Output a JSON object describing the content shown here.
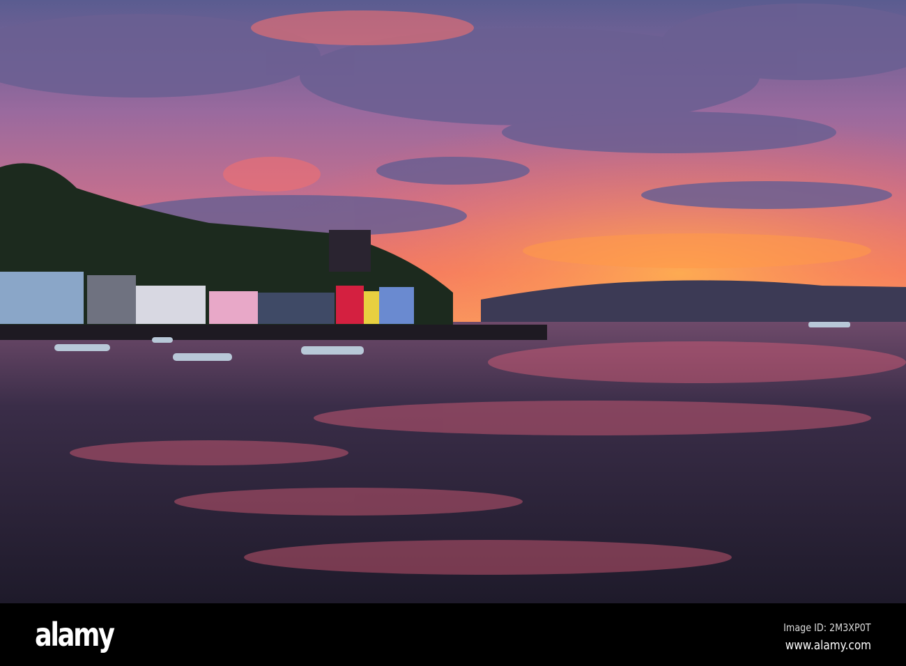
{
  "photo": {
    "subject": "harbour-town-sunset",
    "colors": {
      "sky_top": "#5b5a8e",
      "glow": "#f56a5a",
      "horizon": "#f7904f",
      "water": "#2b2438",
      "hill": "#1d2a1c",
      "mountain": "#3a3a55"
    }
  },
  "watermark": {
    "logo": "alamy",
    "image_id": "Image ID: 2M3XP0T",
    "website": "www.alamy.com"
  }
}
